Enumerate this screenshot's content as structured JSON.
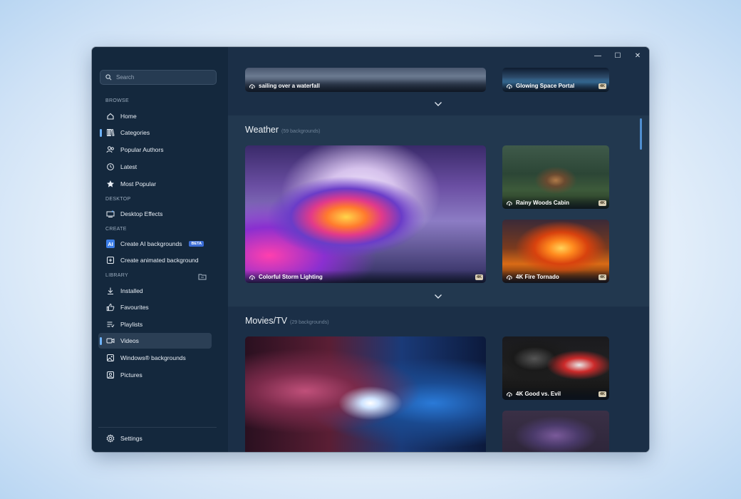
{
  "search": {
    "placeholder": "Search"
  },
  "sidebar": {
    "sections": {
      "browse": "BROWSE",
      "desktop": "DESKTOP",
      "create": "CREATE",
      "library": "LIBRARY"
    },
    "items": {
      "home": "Home",
      "categories": "Categories",
      "popular_authors": "Popular Authors",
      "latest": "Latest",
      "most_popular": "Most Popular",
      "desktop_effects": "Desktop Effects",
      "create_ai": "Create AI backgrounds",
      "create_ai_badge": "BETA",
      "create_animated": "Create animated background",
      "installed": "Installed",
      "favourites": "Favourites",
      "playlists": "Playlists",
      "videos": "Videos",
      "windows_backgrounds": "Windows® backgrounds",
      "pictures": "Pictures",
      "settings": "Settings"
    },
    "ai_icon_text": "AI",
    "active_item": "videos",
    "accent_color": "#6fb4ff"
  },
  "top_section": {
    "cards": [
      {
        "label": "sailing over a waterfall",
        "badge": ""
      },
      {
        "label": "Glowing Space Portal",
        "badge": "4K"
      }
    ]
  },
  "weather": {
    "title": "Weather",
    "count": "(59 backgrounds)",
    "cards": [
      {
        "label": "Colorful Storm Lighting",
        "badge": "4K"
      },
      {
        "label": "Rainy Woods Cabin",
        "badge": "4K"
      },
      {
        "label": "4K Fire Tornado",
        "badge": "4K"
      }
    ]
  },
  "movies": {
    "title": "Movies/TV",
    "count": "(29 backgrounds)",
    "cards": [
      {
        "label": "",
        "badge": ""
      },
      {
        "label": "4K Good vs. Evil",
        "badge": "4K"
      },
      {
        "label": "",
        "badge": ""
      }
    ]
  },
  "window_controls": {
    "minimize": "—",
    "maximize": "☐",
    "close": "✕"
  }
}
